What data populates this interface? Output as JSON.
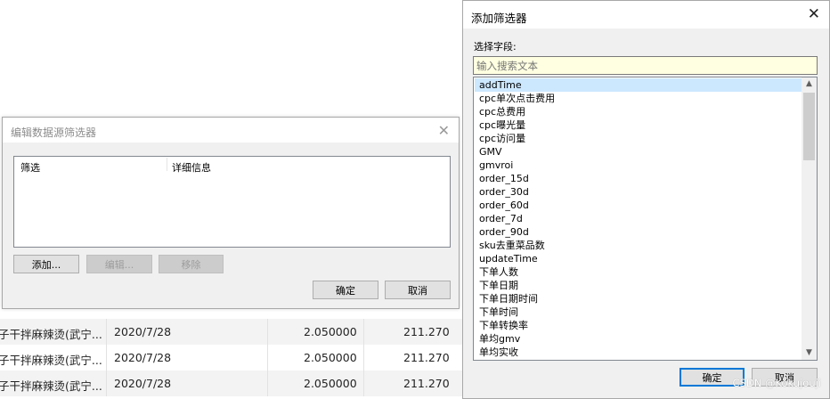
{
  "background_table": {
    "rows": [
      {
        "name": "子干拌麻辣烫(武宁...",
        "date": "2020/7/28",
        "v1": "2.050000",
        "v2": "211.270"
      },
      {
        "name": "子干拌麻辣烫(武宁...",
        "date": "2020/7/28",
        "v1": "2.050000",
        "v2": "211.270"
      },
      {
        "name": "子干拌麻辣烫(武宁...",
        "date": "2020/7/28",
        "v1": "2.050000",
        "v2": "211.270"
      }
    ]
  },
  "edit_dialog": {
    "title": "编辑数据源筛选器",
    "columns": [
      "筛选",
      "详细信息"
    ],
    "add_label": "添加...",
    "edit_label": "编辑...",
    "remove_label": "移除",
    "ok_label": "确定",
    "cancel_label": "取消",
    "close_icon": "close-icon"
  },
  "add_filter_dialog": {
    "title": "添加筛选器",
    "field_label": "选择字段:",
    "search_placeholder": "输入搜索文本",
    "fields": [
      "addTime",
      "cpc单次点击费用",
      "cpc总费用",
      "cpc曝光量",
      "cpc访问量",
      "GMV",
      "gmvroi",
      "order_15d",
      "order_30d",
      "order_60d",
      "order_7d",
      "order_90d",
      "sku去重菜品数",
      "updateTime",
      "下单人数",
      "下单日期",
      "下单日期时间",
      "下单时间",
      "下单转换率",
      "单均gmv",
      "单均实收"
    ],
    "selected_field": "addTime",
    "ok_label": "确定",
    "cancel_label": "取消",
    "close_icon": "close-icon"
  },
  "watermark": "CSDN @Kokujouji"
}
